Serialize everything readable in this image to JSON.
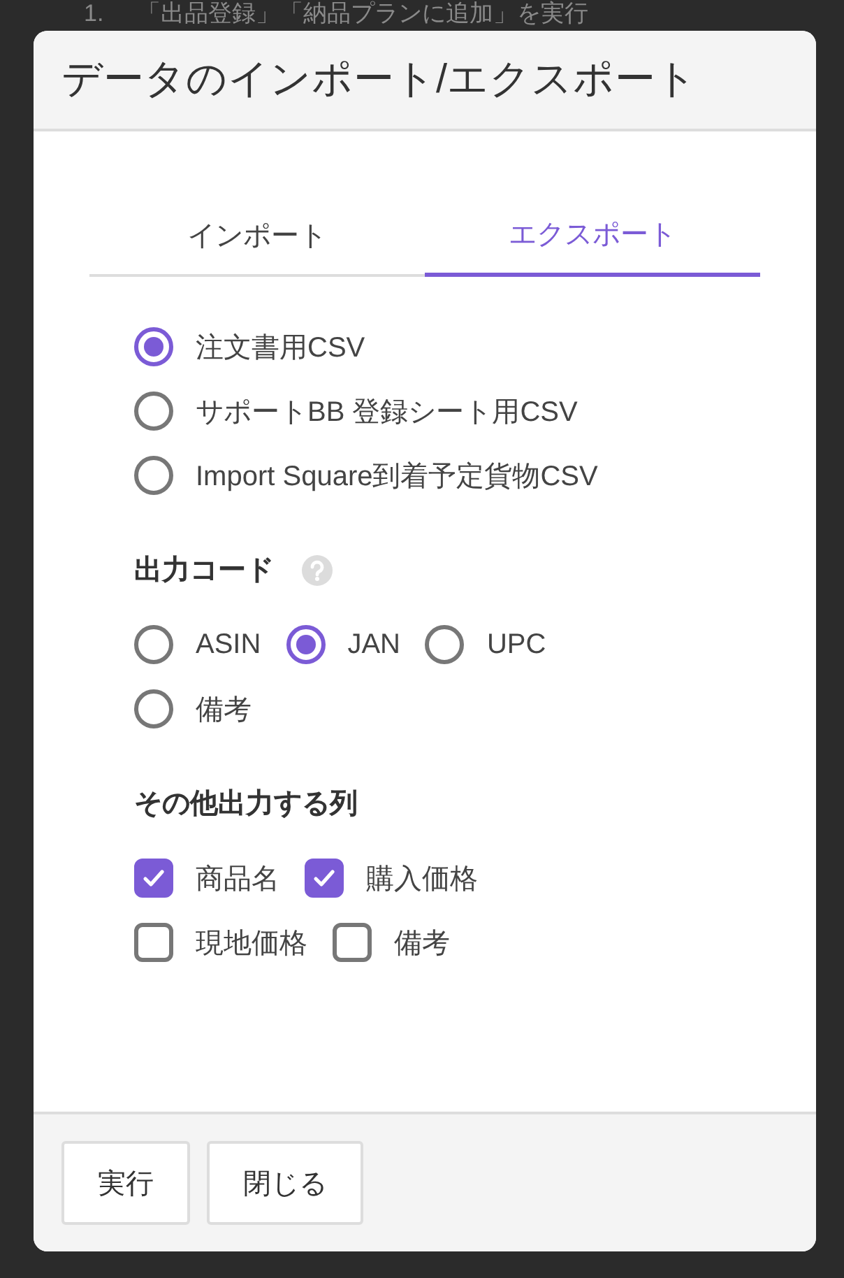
{
  "backdrop": {
    "step_number": "1.",
    "step_text": "「出品登録」「納品プランに追加」を実行"
  },
  "dialog": {
    "title": "データのインポート/エクスポート",
    "tabs": [
      {
        "label": "インポート",
        "selected": false
      },
      {
        "label": "エクスポート",
        "selected": true
      }
    ],
    "formats": [
      {
        "label": "注文書用CSV",
        "selected": true
      },
      {
        "label": "サポートBB 登録シート用CSV",
        "selected": false
      },
      {
        "label": "Import Square到着予定貨物CSV",
        "selected": false
      }
    ],
    "code_section": {
      "heading": "出力コード",
      "options": [
        {
          "label": "ASIN",
          "selected": false
        },
        {
          "label": "JAN",
          "selected": true
        },
        {
          "label": "UPC",
          "selected": false
        },
        {
          "label": "備考",
          "selected": false
        }
      ]
    },
    "columns_section": {
      "heading": "その他出力する列",
      "options": [
        {
          "label": "商品名",
          "checked": true
        },
        {
          "label": "購入価格",
          "checked": true
        },
        {
          "label": "現地価格",
          "checked": false
        },
        {
          "label": "備考",
          "checked": false
        }
      ]
    },
    "buttons": [
      "実行",
      "閉じる"
    ]
  }
}
